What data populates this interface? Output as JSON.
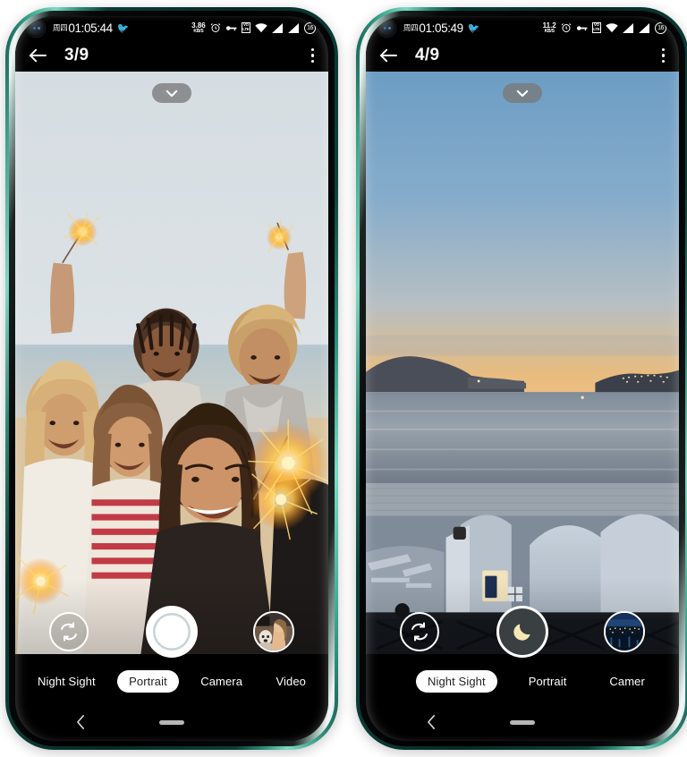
{
  "scene": {
    "background": "#ffffff",
    "device_frame_color": "#2d8d78",
    "device_count": 2
  },
  "phones": [
    {
      "id": "phone-left",
      "status_bar": {
        "day": "周四",
        "clock": "01:05:44",
        "emoji": "🐦",
        "net_speed_value": "3.86",
        "net_speed_unit": "KB/S",
        "icons": [
          "alarm-icon",
          "vpn-key-icon",
          "volte-icon",
          "wifi-icon",
          "signal-icon",
          "signal-icon"
        ],
        "battery_level": "16"
      },
      "app_bar": {
        "back_icon": "arrow-left-icon",
        "title": "3/9",
        "menu_icon": "more-vert-icon"
      },
      "viewfinder": {
        "photo_description": "group-selfie-sparklers",
        "collapse_icon": "chevron-down-icon"
      },
      "controls": {
        "flip_icon": "camera-flip-icon",
        "shutter_type": "ring",
        "shutter_icon": "shutter-ring-icon",
        "thumbnail_description": "woman-with-dog-thumbnail"
      },
      "modes": {
        "items": [
          "Night Sight",
          "Portrait",
          "Camera",
          "Video"
        ],
        "selected": "Portrait"
      },
      "nav_bar": {
        "back_icon": "chevron-left-icon",
        "home_icon": "home-pill-icon"
      }
    },
    {
      "id": "phone-right",
      "status_bar": {
        "day": "周四",
        "clock": "01:05:49",
        "emoji": "🐦",
        "net_speed_value": "11.2",
        "net_speed_unit": "KB/S",
        "icons": [
          "alarm-icon",
          "vpn-key-icon",
          "volte-icon",
          "wifi-icon",
          "signal-icon",
          "signal-icon"
        ],
        "battery_level": "16"
      },
      "app_bar": {
        "back_icon": "arrow-left-icon",
        "title": "4/9",
        "menu_icon": "more-vert-icon"
      },
      "viewfinder": {
        "photo_description": "santorini-sunset-seascape",
        "collapse_icon": "chevron-down-icon"
      },
      "controls": {
        "flip_icon": "camera-flip-icon",
        "shutter_type": "night",
        "shutter_icon": "moon-icon",
        "thumbnail_description": "night-city-coast-thumbnail"
      },
      "modes": {
        "items": [
          "Night Sight",
          "Portrait",
          "Camer"
        ],
        "selected": "Night Sight"
      },
      "nav_bar": {
        "back_icon": "chevron-left-icon",
        "home_icon": "home-pill-icon"
      }
    }
  ]
}
